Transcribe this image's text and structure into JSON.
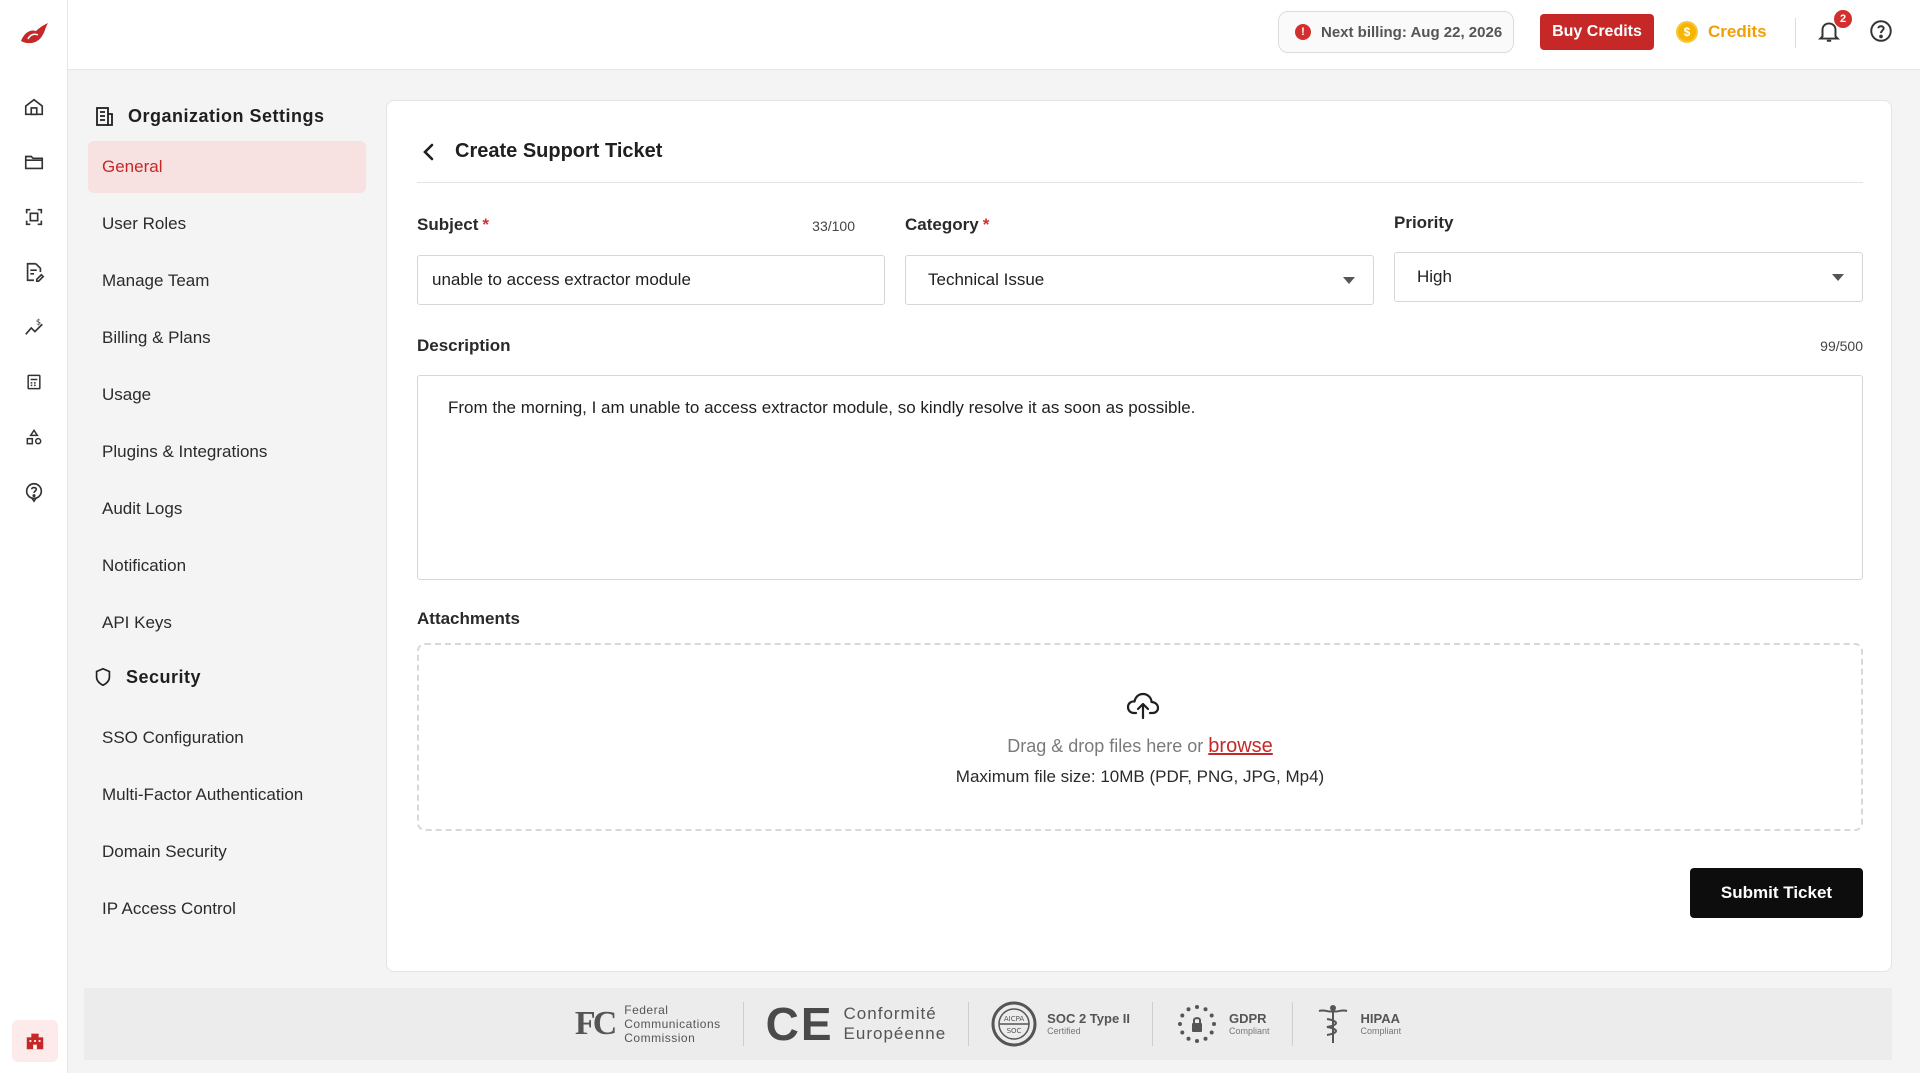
{
  "topbar": {
    "billing_text": "Next billing: Aug 22, 2026",
    "buy_credits_label": "Buy Credits",
    "credits_label": "Credits",
    "notification_count": "2"
  },
  "settings_nav": {
    "org_heading": "Organization Settings",
    "org_items": [
      {
        "label": "General",
        "active": true
      },
      {
        "label": "User Roles"
      },
      {
        "label": "Manage Team"
      },
      {
        "label": "Billing & Plans"
      },
      {
        "label": "Usage"
      },
      {
        "label": "Plugins & Integrations"
      },
      {
        "label": "Audit Logs"
      },
      {
        "label": "Notification"
      },
      {
        "label": "API Keys"
      }
    ],
    "security_heading": "Security",
    "security_items": [
      {
        "label": "SSO Configuration"
      },
      {
        "label": "Multi-Factor Authentication"
      },
      {
        "label": "Domain Security"
      },
      {
        "label": "IP Access Control"
      }
    ]
  },
  "form": {
    "title": "Create Support Ticket",
    "subject_label": "Subject",
    "required_mark": "*",
    "subject_counter": "33/100",
    "subject_value": "unable to access extractor module",
    "category_label": "Category",
    "category_value": "Technical Issue",
    "priority_label": "Priority",
    "priority_value": "High",
    "description_label": "Description",
    "description_counter": "99/500",
    "description_value": "From the morning, I am unable to access extractor module, so kindly resolve it as soon as possible.",
    "attachments_label": "Attachments",
    "drop_text": "Drag & drop files here or ",
    "browse_label": "browse",
    "max_size_text": "Maximum file size: 10MB (PDF, PNG, JPG, Mp4)",
    "submit_label": "Submit Ticket"
  },
  "footer": {
    "fcc_mark": "FC",
    "fcc_lines": [
      "Federal",
      "Communications",
      "Commission"
    ],
    "ce_mark": "CE",
    "ce_lines": [
      "Conformité",
      "Européenne"
    ],
    "soc_seal_top": "AICPA",
    "soc_seal_bottom": "SOC",
    "soc_title": "SOC 2 Type II",
    "soc_sub": "Certified",
    "gdpr_title": "GDPR",
    "gdpr_sub": "Compliant",
    "hipaa_title": "HIPAA",
    "hipaa_sub": "Compliant"
  },
  "colors": {
    "brand_red": "#c62828",
    "credits_orange": "#f29f05",
    "active_nav_bg": "#f7e1e1"
  }
}
